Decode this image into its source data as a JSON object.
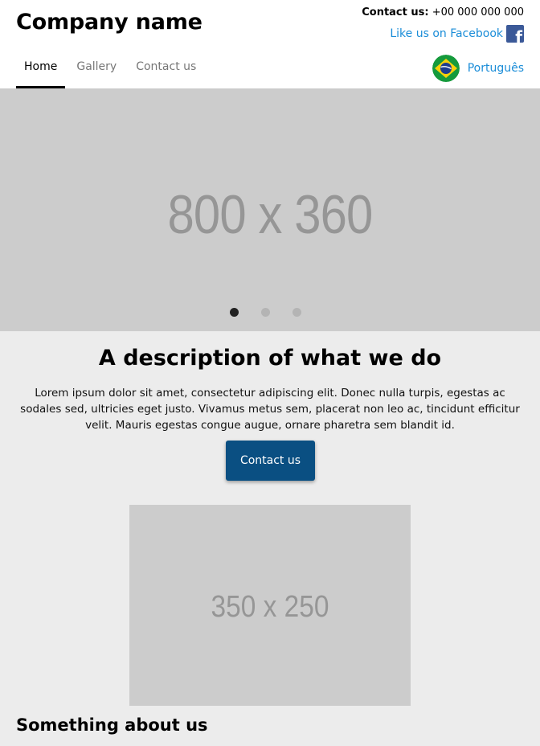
{
  "header": {
    "company_name": "Company name",
    "contact_label": "Contact us:",
    "contact_phone": "+00 000 000 000",
    "facebook_link": "Like us on Facebook",
    "facebook_icon": "facebook-icon",
    "nav": [
      {
        "label": "Home",
        "active": true
      },
      {
        "label": "Gallery",
        "active": false
      },
      {
        "label": "Contact us",
        "active": false
      }
    ],
    "language": {
      "label": "Português",
      "flag_icon": "brazil-flag-icon"
    }
  },
  "hero": {
    "placeholder_text": "800 x 360",
    "slide_count": 3,
    "active_slide": 1
  },
  "main": {
    "title": "A description of what we do",
    "description": "Lorem ipsum dolor sit amet, consectetur adipiscing elit. Donec nulla turpis, egestas ac sodales sed, ultricies eget justo. Vivamus metus sem, placerat non leo ac, tincidunt efficitur velit. Mauris egestas congue augue, ornare pharetra sem blandit id.",
    "cta_label": "Contact us",
    "image_placeholder_text": "350 x 250",
    "about_title": "Something about us"
  },
  "colors": {
    "accent_link": "#1b8dd8",
    "button": "#0a4f82",
    "facebook": "#3b5998",
    "placeholder": "#cccccc",
    "page_bg": "#ececec"
  }
}
